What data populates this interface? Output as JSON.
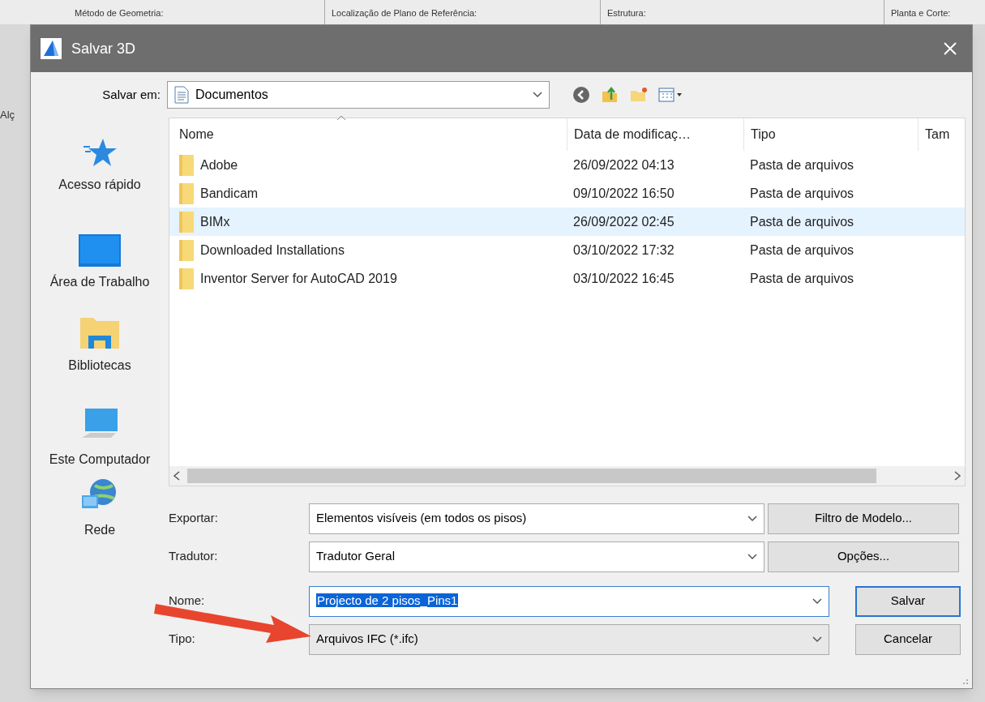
{
  "background": {
    "fields": [
      "Método de Geometria:",
      "Localização de Plano de Referência:",
      "Estrutura:",
      "Planta e Corte:"
    ],
    "side_label": "Alç"
  },
  "dialog": {
    "title": "Salvar 3D",
    "save_in": {
      "label": "Salvar em:",
      "value": "Documentos"
    },
    "places": [
      {
        "kind": "star",
        "label": "Acesso rápido"
      },
      {
        "kind": "desktop",
        "label": "Área de Trabalho"
      },
      {
        "kind": "library",
        "label": "Bibliotecas"
      },
      {
        "kind": "computer",
        "label": "Este Computador"
      },
      {
        "kind": "network",
        "label": "Rede"
      }
    ],
    "columns": [
      "Nome",
      "Data de modificaç…",
      "Tipo",
      "Tam"
    ],
    "rows": [
      {
        "name": "Adobe",
        "date": "26/09/2022 04:13",
        "type": "Pasta de arquivos",
        "selected": false
      },
      {
        "name": "Bandicam",
        "date": "09/10/2022 16:50",
        "type": "Pasta de arquivos",
        "selected": false
      },
      {
        "name": "BIMx",
        "date": "26/09/2022 02:45",
        "type": "Pasta de arquivos",
        "selected": true
      },
      {
        "name": "Downloaded Installations",
        "date": "03/10/2022 17:32",
        "type": "Pasta de arquivos",
        "selected": false
      },
      {
        "name": "Inventor Server for AutoCAD 2019",
        "date": "03/10/2022 16:45",
        "type": "Pasta de arquivos",
        "selected": false
      }
    ],
    "fields": [
      {
        "label": "Exportar:",
        "value": "Elementos visíveis (em todos os pisos)",
        "button": "Filtro de Modelo...",
        "editable": false
      },
      {
        "label": "Tradutor:",
        "value": "Tradutor Geral",
        "button": "Opções...",
        "editable": false
      },
      {
        "label": "Nome:",
        "value": "Projecto de 2 pisos_Pins1",
        "button": "Salvar",
        "editable": true
      },
      {
        "label": "Tipo:",
        "value": "Arquivos IFC (*.ifc)",
        "button": "Cancelar",
        "editable": false
      }
    ]
  }
}
